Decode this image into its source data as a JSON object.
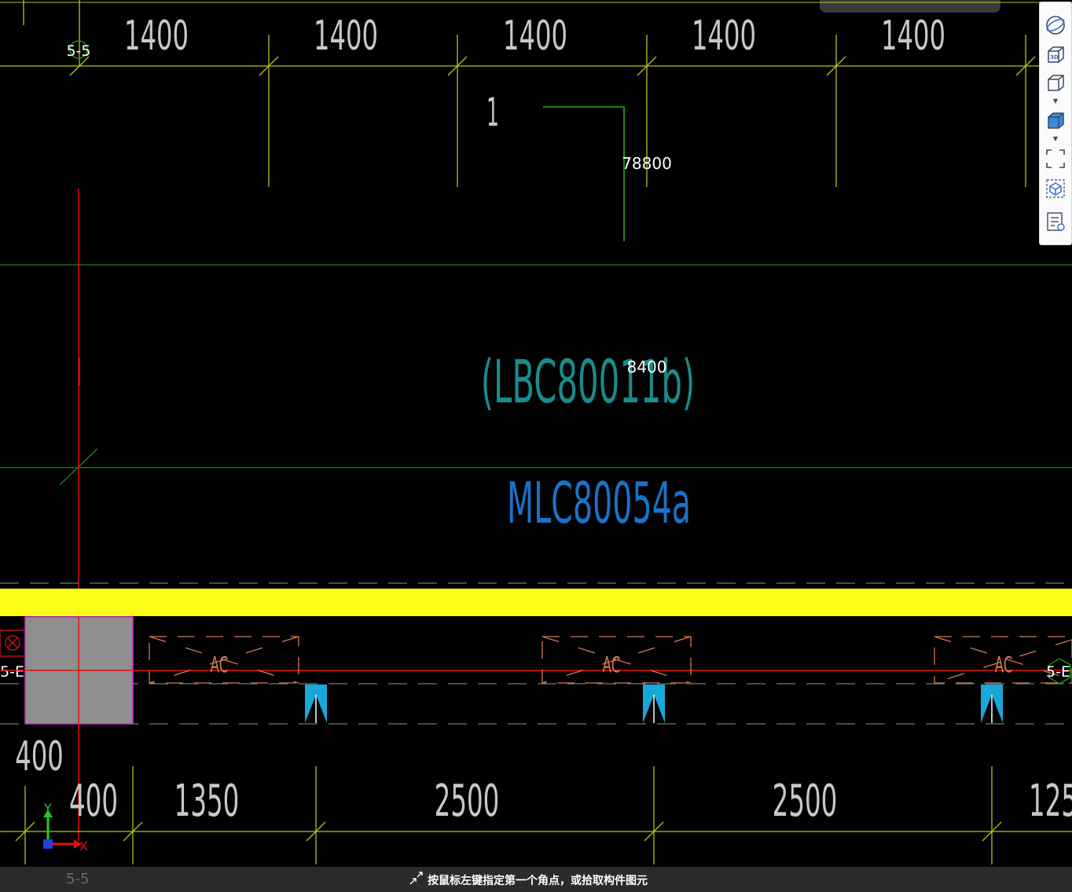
{
  "drawing": {
    "top_dims": [
      "1400",
      "1400",
      "1400",
      "1400",
      "1400"
    ],
    "grid_label_top": "5-5",
    "section_mark": "1",
    "elevation_1": "78800",
    "elevation_2": "8400",
    "slab_label": "(LBC80011b)",
    "beam_label": "MLC80054a",
    "ac_label": "AC",
    "left_grid": "5-E",
    "right_grid": "5-E",
    "dim_400_upper": "400",
    "bottom_dims": [
      "400",
      "1350",
      "2500",
      "2500",
      "125"
    ],
    "axis_y": "Y",
    "axis_x": "X"
  },
  "toolbar": {
    "icons": [
      "orbit-icon",
      "view-3d-icon",
      "view-box-icon",
      "shaded-box-icon",
      "zoom-extents-icon",
      "isometric-icon",
      "properties-icon"
    ]
  },
  "status": {
    "message": "按鼠标左键指定第一个角点，或拾取构件图元",
    "grid_label": "5-5"
  },
  "colors": {
    "background": "#000000",
    "grid_line": "#b5c31a",
    "green_line": "#22aa22",
    "red_axis": "#e01010",
    "yellow_beam": "#ffff1a",
    "ac_color": "#d27a55",
    "cyan_marker": "#18a8d8",
    "slab_text": "#1b8b8b",
    "beam_text": "#1a72c8"
  }
}
